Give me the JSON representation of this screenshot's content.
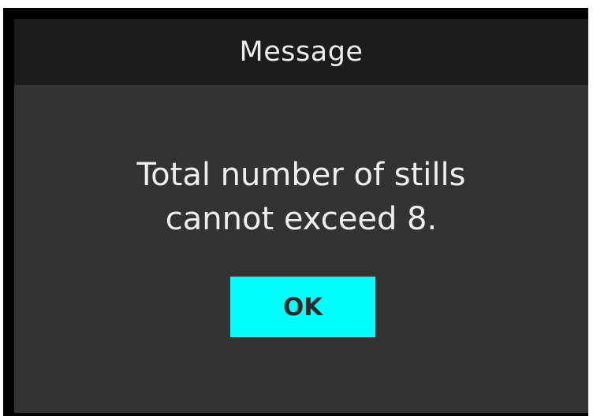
{
  "dialog": {
    "title": "Message",
    "message_line_1": "Total number of stills",
    "message_line_2": "cannot exceed 8.",
    "ok_label": "OK"
  },
  "colors": {
    "title_bar": "#1c1c1c",
    "body": "#333333",
    "frame": "#000000",
    "ok_button": "#00ffff",
    "text": "#eeeeee"
  }
}
